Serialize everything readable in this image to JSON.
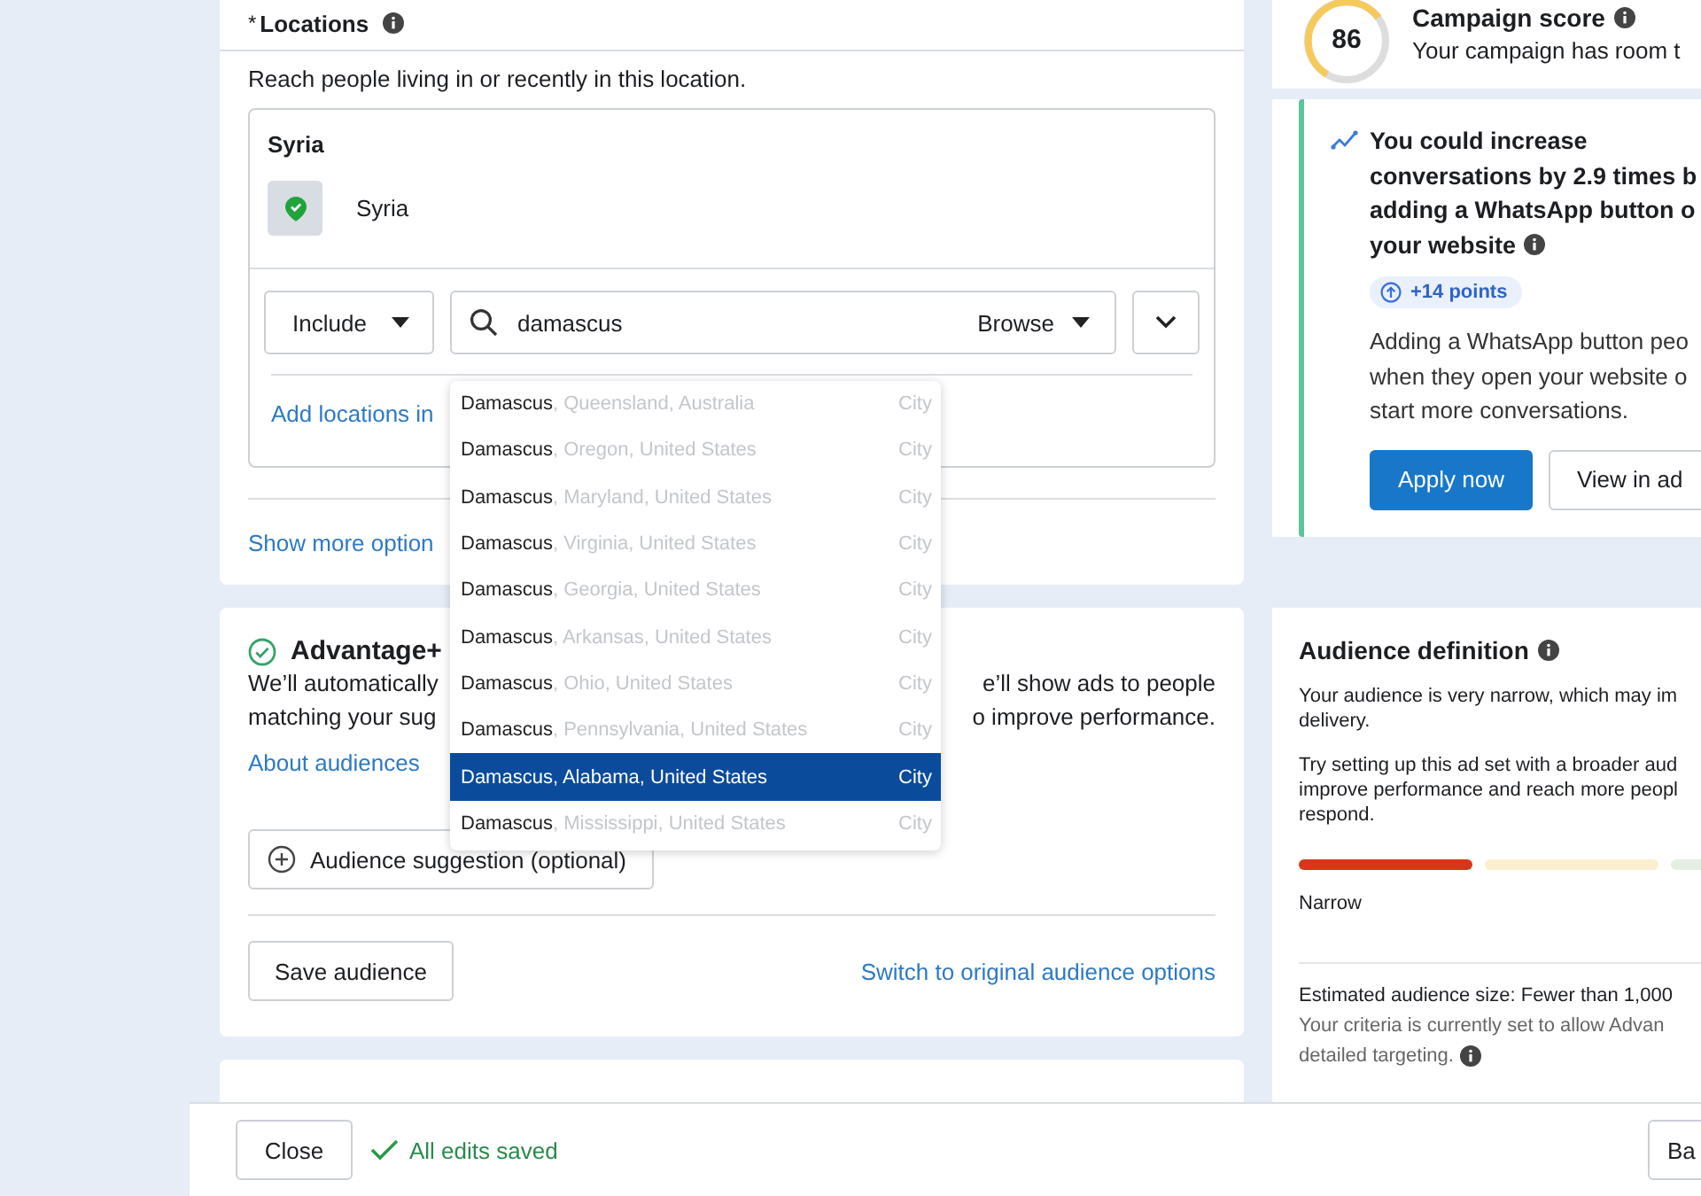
{
  "locations": {
    "title": "Locations",
    "required_mark": "*",
    "description": "Reach people living in or recently in this location.",
    "group_title": "Syria",
    "selected": [
      {
        "name": "Syria"
      }
    ],
    "include_select": {
      "value": "Include"
    },
    "search": {
      "value": "damascus",
      "browse": "Browse"
    },
    "add_link": "Add locations in",
    "suggestions": [
      {
        "name": "Damascus",
        "region": ", Queensland, Australia",
        "type": "City",
        "selected": false
      },
      {
        "name": "Damascus",
        "region": ", Oregon, United States",
        "type": "City",
        "selected": false
      },
      {
        "name": "Damascus",
        "region": ", Maryland, United States",
        "type": "City",
        "selected": false
      },
      {
        "name": "Damascus",
        "region": ", Virginia, United States",
        "type": "City",
        "selected": false
      },
      {
        "name": "Damascus",
        "region": ", Georgia, United States",
        "type": "City",
        "selected": false
      },
      {
        "name": "Damascus",
        "region": ", Arkansas, United States",
        "type": "City",
        "selected": false
      },
      {
        "name": "Damascus",
        "region": ", Ohio, United States",
        "type": "City",
        "selected": false
      },
      {
        "name": "Damascus",
        "region": ", Pennsylvania, United States",
        "type": "City",
        "selected": false
      },
      {
        "name": "Damascus",
        "region": ", Alabama, United States",
        "type": "City",
        "selected": true
      },
      {
        "name": "Damascus",
        "region": ", Mississippi, United States",
        "type": "City",
        "selected": false
      }
    ],
    "more_options": "Show more option"
  },
  "advantage": {
    "title": "Advantage+",
    "description_lines": [
      {
        "left": "We’ll automatically",
        "right": "e’ll show ads to people"
      },
      {
        "left": "matching your sug",
        "right": "o improve performance."
      }
    ],
    "about_link": "About audiences",
    "suggestion_button": "Audience suggestion (optional)",
    "save_button": "Save audience",
    "switch_link": "Switch to original audience options"
  },
  "score": {
    "value": "86",
    "title": "Campaign score",
    "subtitle": "Your campaign has room t"
  },
  "recommendation": {
    "title_lines": [
      "You could increase",
      "conversations by 2.9 times b",
      "adding a WhatsApp button o",
      "your website"
    ],
    "points": "+14 points",
    "body_lines": [
      "Adding a WhatsApp button peo",
      "when they open your website o",
      "start more conversations."
    ],
    "buttons": [
      {
        "label": "Apply now",
        "primary": true
      },
      {
        "label": "View in ad",
        "primary": false
      }
    ]
  },
  "audience": {
    "title": "Audience definition",
    "paragraphs": [
      [
        "Your audience is very narrow, which may im",
        "delivery."
      ],
      [
        "Try setting up this ad set with a broader aud",
        "improve performance and reach more peopl",
        "respond."
      ]
    ],
    "meter": [
      {
        "color": "#d8361a"
      },
      {
        "color": "#fbefcf"
      },
      {
        "color": "#e5eee2"
      }
    ],
    "meter_label": "Narrow",
    "size": "Estimated audience size: Fewer than 1,000",
    "note_lines": [
      "Your criteria is currently set to allow Advan",
      "detailed targeting."
    ]
  },
  "footer": {
    "close": "Close",
    "status": "All edits saved",
    "next": "Ba"
  }
}
